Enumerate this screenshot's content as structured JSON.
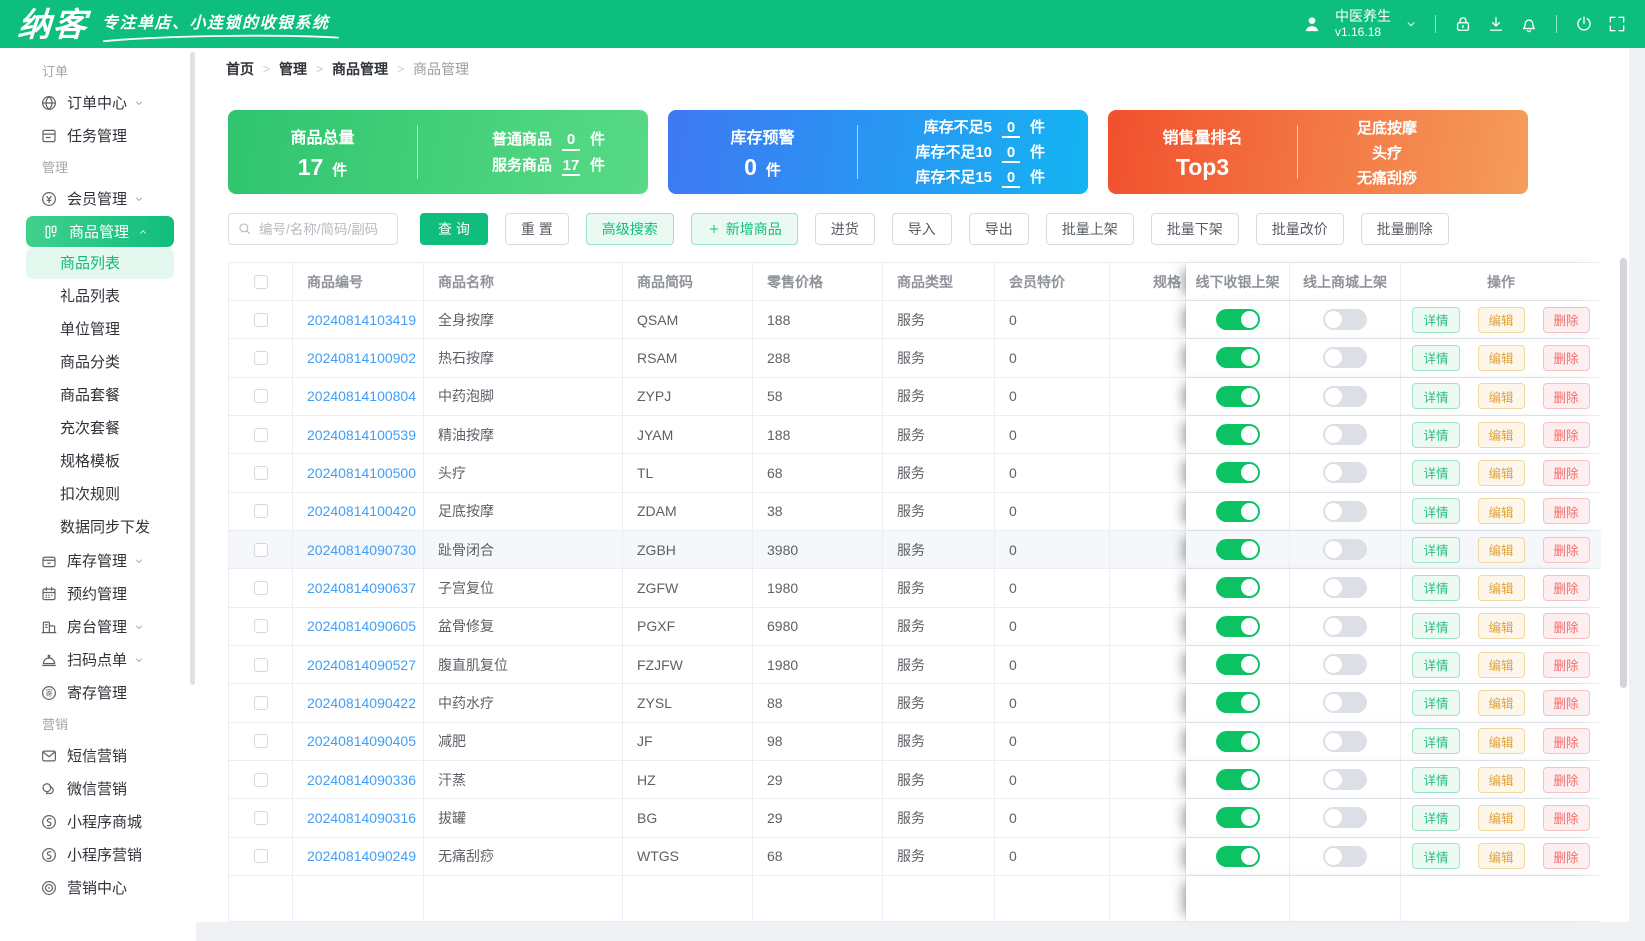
{
  "header": {
    "logo": "纳客",
    "tagline": "专注单店、小连锁的收银系统",
    "store_name": "中医养生",
    "version": "v1.16.18"
  },
  "breadcrumb": [
    "首页",
    "管理",
    "商品管理",
    "商品管理"
  ],
  "sidebar": {
    "sections": [
      {
        "label": "订单",
        "items": [
          {
            "name": "order-center",
            "icon": "order-center-icon",
            "label": "订单中心",
            "expandable": true
          },
          {
            "name": "task-management",
            "icon": "task-icon",
            "label": "任务管理"
          }
        ]
      },
      {
        "label": "管理",
        "items": [
          {
            "name": "member-management",
            "icon": "member-icon",
            "label": "会员管理",
            "expandable": true
          },
          {
            "name": "product-management",
            "icon": "goods-icon",
            "label": "商品管理",
            "expandable": true,
            "expanded": true,
            "active": true,
            "children": [
              {
                "name": "product-list",
                "label": "商品列表",
                "active": true
              },
              {
                "name": "gift-list",
                "label": "礼品列表"
              },
              {
                "name": "unit-management",
                "label": "单位管理"
              },
              {
                "name": "product-category",
                "label": "商品分类"
              },
              {
                "name": "product-package",
                "label": "商品套餐"
              },
              {
                "name": "recharge-package",
                "label": "充次套餐"
              },
              {
                "name": "spec-template",
                "label": "规格模板"
              },
              {
                "name": "deduction-rule",
                "label": "扣次规则"
              },
              {
                "name": "data-sync",
                "label": "数据同步下发"
              }
            ]
          },
          {
            "name": "inventory-management",
            "icon": "inventory-icon",
            "label": "库存管理",
            "expandable": true
          },
          {
            "name": "booking-management",
            "icon": "booking-icon",
            "label": "预约管理"
          },
          {
            "name": "room-management",
            "icon": "room-icon",
            "label": "房台管理",
            "expandable": true
          },
          {
            "name": "scan-order",
            "icon": "scan-order-icon",
            "label": "扫码点单",
            "expandable": true
          },
          {
            "name": "deposit-management",
            "icon": "deposit-icon",
            "label": "寄存管理"
          }
        ]
      },
      {
        "label": "营销",
        "items": [
          {
            "name": "sms-marketing",
            "icon": "sms-icon",
            "label": "短信营销"
          },
          {
            "name": "wechat-marketing",
            "icon": "wechat-icon",
            "label": "微信营销"
          },
          {
            "name": "miniapp-mall",
            "icon": "miniapp-mall-icon",
            "label": "小程序商城"
          },
          {
            "name": "miniapp-marketing",
            "icon": "miniapp-marketing-icon",
            "label": "小程序营销"
          },
          {
            "name": "marketing-center",
            "icon": "marketing-center-icon",
            "label": "营销中心"
          }
        ]
      }
    ]
  },
  "stats_cards": [
    {
      "name": "total-products-card",
      "theme": "green",
      "left_title": "商品总量",
      "left_value": "17",
      "left_unit": "件",
      "lines": [
        {
          "label": "普通商品",
          "value": "0",
          "unit": "件"
        },
        {
          "label": "服务商品",
          "value": "17",
          "unit": "件"
        }
      ]
    },
    {
      "name": "stock-warning-card",
      "theme": "blue",
      "left_title": "库存预警",
      "left_value": "0",
      "left_unit": "件",
      "lines": [
        {
          "label": "库存不足5",
          "value": "0",
          "unit": "件"
        },
        {
          "label": "库存不足10",
          "value": "0",
          "unit": "件"
        },
        {
          "label": "库存不足15",
          "value": "0",
          "unit": "件"
        }
      ]
    },
    {
      "name": "sales-ranking-card",
      "theme": "orange",
      "left_title": "销售量排名",
      "left_value": "Top3",
      "lines": [
        {
          "text": "足底按摩"
        },
        {
          "text": "头疗"
        },
        {
          "text": "无痛刮痧"
        }
      ]
    }
  ],
  "toolbar": {
    "search_placeholder": "编号/名称/简码/副码",
    "buttons": [
      {
        "name": "query-button",
        "label": "查 询",
        "style": "primary"
      },
      {
        "name": "reset-button",
        "label": "重 置",
        "style": "plain"
      },
      {
        "name": "advanced-search-button",
        "label": "高级搜索",
        "style": "tinted"
      },
      {
        "name": "add-product-button",
        "label": "新增商品",
        "style": "tinted",
        "icon": "plus"
      },
      {
        "name": "purchase-button",
        "label": "进货",
        "style": "plain"
      },
      {
        "name": "import-button",
        "label": "导入",
        "style": "plain"
      },
      {
        "name": "export-button",
        "label": "导出",
        "style": "plain"
      },
      {
        "name": "batch-on-shelf-button",
        "label": "批量上架",
        "style": "plain"
      },
      {
        "name": "batch-off-shelf-button",
        "label": "批量下架",
        "style": "plain"
      },
      {
        "name": "batch-reprice-button",
        "label": "批量改价",
        "style": "plain"
      },
      {
        "name": "batch-delete-button",
        "label": "批量删除",
        "style": "plain"
      }
    ]
  },
  "table": {
    "columns": [
      "商品编号",
      "商品名称",
      "商品简码",
      "零售价格",
      "商品类型",
      "会员特价",
      "规格",
      "线下收银上架",
      "线上商城上架",
      "操作"
    ],
    "row_actions": [
      {
        "name": "detail-button",
        "label": "详情",
        "style": "detail"
      },
      {
        "name": "edit-button",
        "label": "编辑",
        "style": "edit"
      },
      {
        "name": "delete-button",
        "label": "删除",
        "style": "del"
      }
    ],
    "rows": [
      {
        "id": "20240814103419",
        "name": "全身按摩",
        "code": "QSAM",
        "price": "188",
        "type": "服务",
        "vip": "0",
        "offline": true,
        "online": false
      },
      {
        "id": "20240814100902",
        "name": "热石按摩",
        "code": "RSAM",
        "price": "288",
        "type": "服务",
        "vip": "0",
        "offline": true,
        "online": false
      },
      {
        "id": "20240814100804",
        "name": "中药泡脚",
        "code": "ZYPJ",
        "price": "58",
        "type": "服务",
        "vip": "0",
        "offline": true,
        "online": false
      },
      {
        "id": "20240814100539",
        "name": "精油按摩",
        "code": "JYAM",
        "price": "188",
        "type": "服务",
        "vip": "0",
        "offline": true,
        "online": false
      },
      {
        "id": "20240814100500",
        "name": "头疗",
        "code": "TL",
        "price": "68",
        "type": "服务",
        "vip": "0",
        "offline": true,
        "online": false
      },
      {
        "id": "20240814100420",
        "name": "足底按摩",
        "code": "ZDAM",
        "price": "38",
        "type": "服务",
        "vip": "0",
        "offline": true,
        "online": false
      },
      {
        "id": "20240814090730",
        "name": "趾骨闭合",
        "code": "ZGBH",
        "price": "3980",
        "type": "服务",
        "vip": "0",
        "offline": true,
        "online": false,
        "highlight": true
      },
      {
        "id": "20240814090637",
        "name": "子宫复位",
        "code": "ZGFW",
        "price": "1980",
        "type": "服务",
        "vip": "0",
        "offline": true,
        "online": false
      },
      {
        "id": "20240814090605",
        "name": "盆骨修复",
        "code": "PGXF",
        "price": "6980",
        "type": "服务",
        "vip": "0",
        "offline": true,
        "online": false
      },
      {
        "id": "20240814090527",
        "name": "腹直肌复位",
        "code": "FZJFW",
        "price": "1980",
        "type": "服务",
        "vip": "0",
        "offline": true,
        "online": false
      },
      {
        "id": "20240814090422",
        "name": "中药水疗",
        "code": "ZYSL",
        "price": "88",
        "type": "服务",
        "vip": "0",
        "offline": true,
        "online": false
      },
      {
        "id": "20240814090405",
        "name": "减肥",
        "code": "JF",
        "price": "98",
        "type": "服务",
        "vip": "0",
        "offline": true,
        "online": false
      },
      {
        "id": "20240814090336",
        "name": "汗蒸",
        "code": "HZ",
        "price": "29",
        "type": "服务",
        "vip": "0",
        "offline": true,
        "online": false
      },
      {
        "id": "20240814090316",
        "name": "拔罐",
        "code": "BG",
        "price": "29",
        "type": "服务",
        "vip": "0",
        "offline": true,
        "online": false
      },
      {
        "id": "20240814090249",
        "name": "无痛刮痧",
        "code": "WTGS",
        "price": "68",
        "type": "服务",
        "vip": "0",
        "offline": true,
        "online": false
      }
    ]
  },
  "colors": {
    "brand_green": "#0dbe7f",
    "link_blue": "#3f9ef8",
    "toggle_on": "#0cc363",
    "card_green": "#2fc46e",
    "card_blue": "#3e78f2",
    "card_orange": "#f1502d"
  }
}
